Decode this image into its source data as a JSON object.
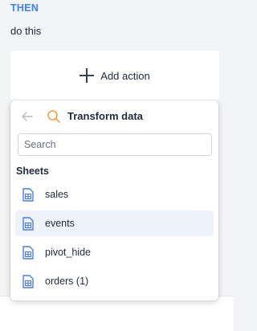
{
  "then_block": {
    "heading": "THEN",
    "subheading": "do this",
    "add_action_label": "Add action"
  },
  "popover": {
    "title": "Transform data",
    "search": {
      "placeholder": "Search",
      "value": ""
    },
    "section_title": "Sheets",
    "sheets": [
      {
        "name": "sales",
        "selected": false
      },
      {
        "name": "events",
        "selected": true
      },
      {
        "name": "pivot_hide",
        "selected": false
      },
      {
        "name": "orders (1)",
        "selected": false
      }
    ]
  },
  "colors": {
    "accent_blue": "#3b82f6",
    "search_icon_orange": "#f59e42",
    "selected_row_bg": "#eef2fb",
    "sheet_icon_blue": "#4a7de8"
  },
  "icons": {
    "back": "arrow-left-icon",
    "search": "search-icon",
    "add": "plus-icon",
    "sheet": "sheet-file-icon"
  }
}
